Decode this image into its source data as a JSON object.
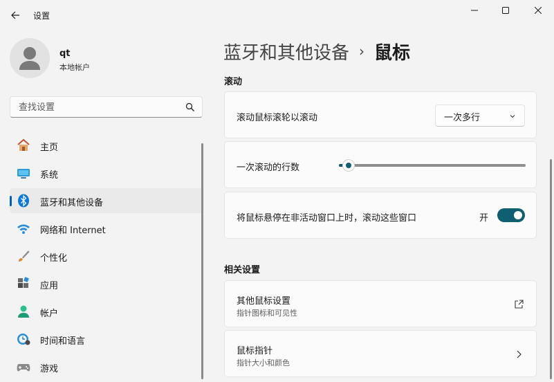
{
  "window": {
    "title": "设置"
  },
  "user": {
    "name": "qt",
    "account_type": "本地帐户"
  },
  "search": {
    "placeholder": "查找设置"
  },
  "nav": {
    "items": [
      {
        "label": "主页",
        "icon": "home-icon"
      },
      {
        "label": "系统",
        "icon": "system-icon"
      },
      {
        "label": "蓝牙和其他设备",
        "icon": "bluetooth-icon",
        "active": true
      },
      {
        "label": "网络和 Internet",
        "icon": "wifi-icon"
      },
      {
        "label": "个性化",
        "icon": "brush-icon"
      },
      {
        "label": "应用",
        "icon": "apps-icon"
      },
      {
        "label": "帐户",
        "icon": "account-icon"
      },
      {
        "label": "时间和语言",
        "icon": "clock-globe-icon"
      },
      {
        "label": "游戏",
        "icon": "gamepad-icon"
      }
    ]
  },
  "breadcrumb": {
    "parent": "蓝牙和其他设备",
    "separator": "›",
    "current": "鼠标"
  },
  "scroll_section": {
    "title": "滚动",
    "wheel_label": "滚动鼠标滚轮以滚动",
    "wheel_value": "一次多行",
    "lines_label": "一次滚动的行数",
    "lines_fraction": 0.05,
    "inactive_label": "将鼠标悬停在非活动窗口上时，滚动这些窗口",
    "inactive_state": "开"
  },
  "related_section": {
    "title": "相关设置",
    "items": [
      {
        "title": "其他鼠标设置",
        "subtitle": "指针图标和可见性",
        "icon": "external-link-icon"
      },
      {
        "title": "鼠标指针",
        "subtitle": "指针大小和颜色",
        "icon": "chevron-right-icon"
      }
    ]
  },
  "colors": {
    "accent": "#0f5e72",
    "nav_indicator": "#005fb8",
    "background": "#f3f3f3",
    "card": "#fbfbfb"
  }
}
